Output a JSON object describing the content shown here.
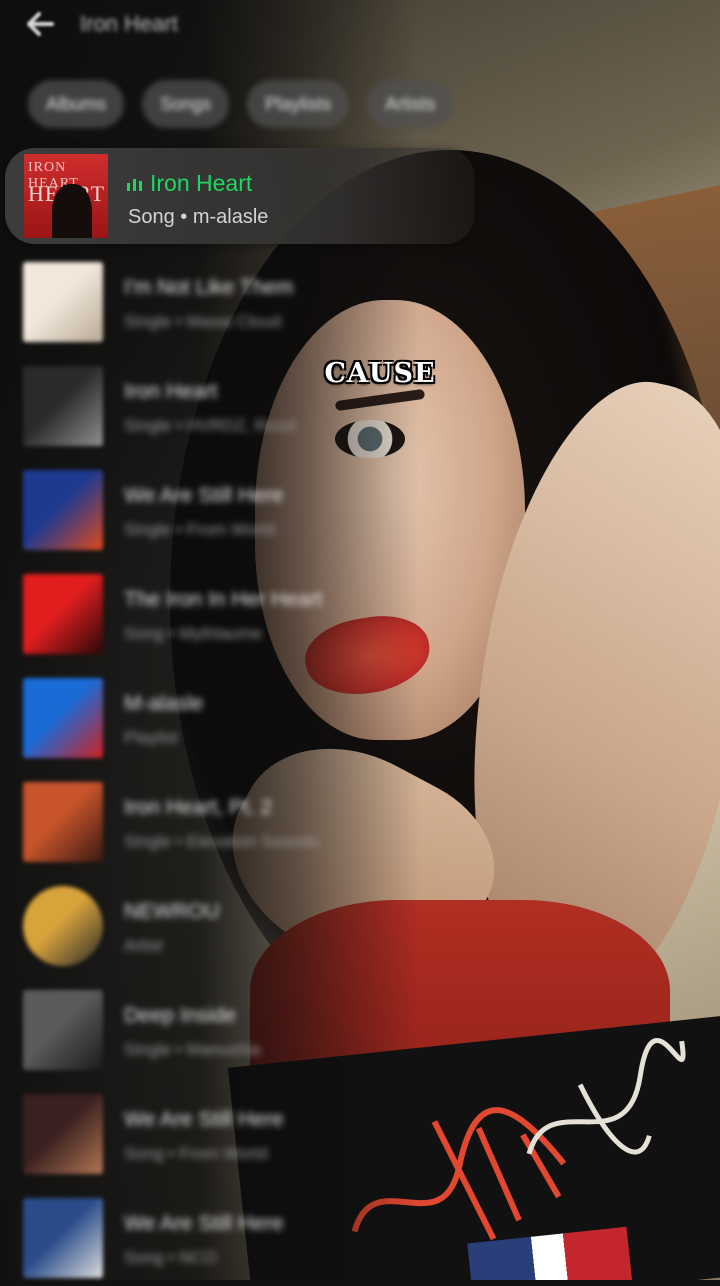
{
  "header": {
    "back_icon": "arrow-left-icon",
    "query": "Iron Heart"
  },
  "chips": [
    "Albums",
    "Songs",
    "Playlists",
    "Artists"
  ],
  "now_playing": {
    "title": "Iron Heart",
    "subtitle": "Song • m-alasle",
    "art_text_1": "IRON HEART",
    "art_text_2": "HEART",
    "accent": "#1ed760",
    "indicator_icon": "equalizer-icon"
  },
  "results": [
    {
      "title": "I'm Not Like Them",
      "subtitle": "Single • Masai Cloud",
      "art": [
        "#f1e7da",
        "#b9aa98"
      ]
    },
    {
      "title": "Iron Heart",
      "subtitle": "Single • HVRDZ, Rxzzl",
      "art": [
        "#2a2a2a",
        "#8f8f8f"
      ]
    },
    {
      "title": "We Are Still Here",
      "subtitle": "Single • From World",
      "art": [
        "#1d3a8f",
        "#e14a1d"
      ]
    },
    {
      "title": "The Iron In Her Heart",
      "subtitle": "Song • Mythlaume",
      "art": [
        "#e01e1e",
        "#2a0808"
      ]
    },
    {
      "title": "M-alasle",
      "subtitle": "Playlist",
      "art": [
        "#1a6bd6",
        "#d32020"
      ]
    },
    {
      "title": "Iron Heart, Pt. 2",
      "subtitle": "Single • Elevation Sounds",
      "art": [
        "#c8542b",
        "#3a1a12"
      ]
    },
    {
      "title": "NEWROU",
      "subtitle": "Artist",
      "art": [
        "#d8a33b",
        "#2b2b2b"
      ],
      "round": true
    },
    {
      "title": "Deep Inside",
      "subtitle": "Single • Manushia",
      "art": [
        "#5a5a5a",
        "#1b1b1b"
      ]
    },
    {
      "title": "We Are Still Here",
      "subtitle": "Song • From World",
      "art": [
        "#3a2020",
        "#b27654"
      ]
    },
    {
      "title": "We Are Still Here",
      "subtitle": "Song • NCO",
      "art": [
        "#2a4b8a",
        "#dcdcdc"
      ]
    }
  ],
  "caption": "CAUSE",
  "shirt_logo": "Tommy Hilfiger"
}
